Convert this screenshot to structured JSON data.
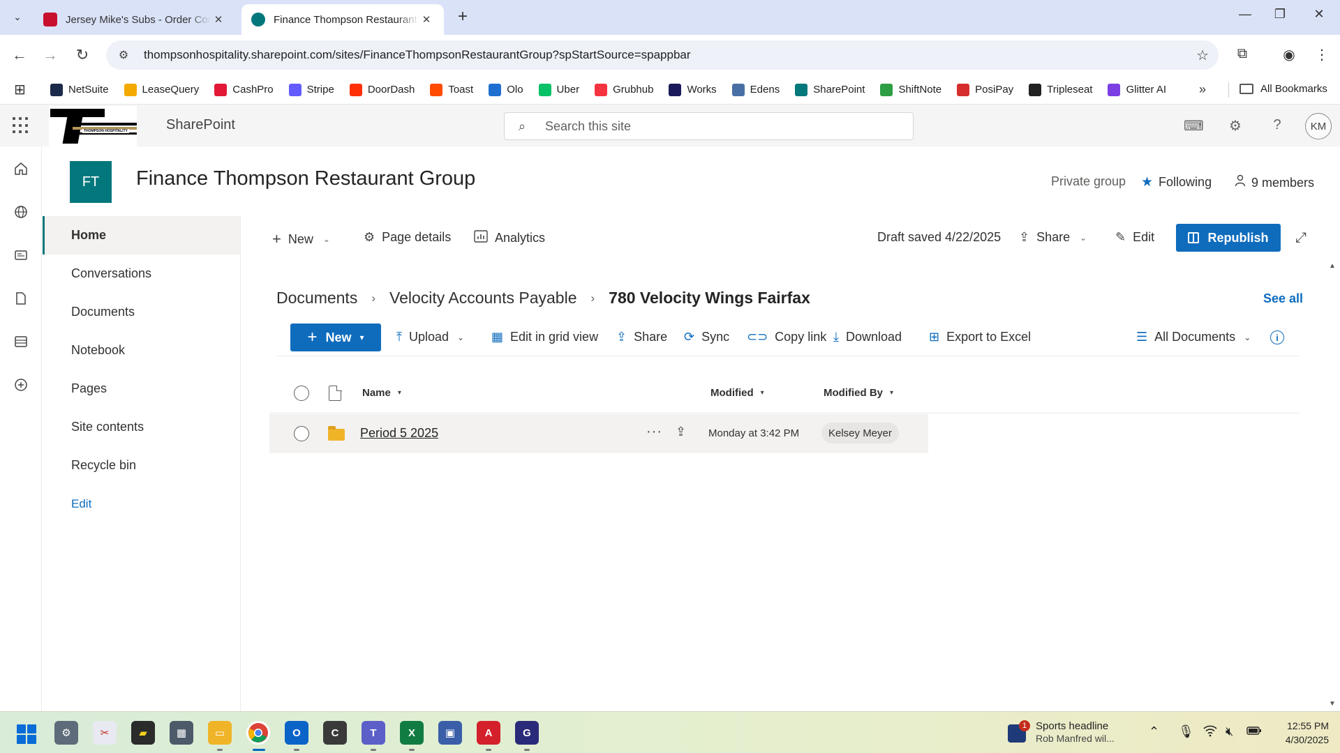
{
  "browser": {
    "tabs": [
      {
        "title": "Jersey Mike's Subs - Order Com",
        "active": false,
        "favicon_color": "#c8102e"
      },
      {
        "title": "Finance Thompson Restaurant G",
        "active": true,
        "favicon_color": "#03787c"
      }
    ],
    "new_tab_symbol": "+",
    "url": "thompsonhospitality.sharepoint.com/sites/FinanceThompsonRestaurantGroup?spStartSource=spappbar",
    "bookmarks": [
      {
        "label": "NetSuite",
        "color": "#1b2a4a",
        "icon": "netsuite-icon"
      },
      {
        "label": "LeaseQuery",
        "color": "#f2a900",
        "icon": "leasequery-icon"
      },
      {
        "label": "CashPro",
        "color": "#e31837",
        "icon": "cashpro-icon"
      },
      {
        "label": "Stripe",
        "color": "#635bff",
        "icon": "stripe-icon"
      },
      {
        "label": "DoorDash",
        "color": "#ff3008",
        "icon": "doordash-icon"
      },
      {
        "label": "Toast",
        "color": "#ff4c00",
        "icon": "toast-icon"
      },
      {
        "label": "Olo",
        "color": "#1f6fd1",
        "icon": "olo-icon"
      },
      {
        "label": "Uber",
        "color": "#06c167",
        "icon": "uber-icon"
      },
      {
        "label": "Grubhub",
        "color": "#f63440",
        "icon": "grubhub-icon"
      },
      {
        "label": "Works",
        "color": "#1a1a5a",
        "icon": "works-icon"
      },
      {
        "label": "Edens",
        "color": "#4a6fa5",
        "icon": "edens-icon"
      },
      {
        "label": "SharePoint",
        "color": "#03787c",
        "icon": "sharepoint-icon"
      },
      {
        "label": "ShiftNote",
        "color": "#2e9e44",
        "icon": "shiftnote-icon"
      },
      {
        "label": "PosiPay",
        "color": "#d62e2e",
        "icon": "posipay-icon"
      },
      {
        "label": "Tripleseat",
        "color": "#222222",
        "icon": "tripleseat-icon"
      },
      {
        "label": "Glitter AI",
        "color": "#7b3fe4",
        "icon": "glitter-ai-icon"
      }
    ],
    "all_bookmarks": "All Bookmarks"
  },
  "suite": {
    "brand": "SharePoint",
    "logo_text": "THOMPSON HOSPITALITY",
    "search_placeholder": "Search this site",
    "avatar_initials": "KM"
  },
  "site": {
    "logo_initials": "FT",
    "title": "Finance Thompson Restaurant Group",
    "privacy": "Private group",
    "following": "Following",
    "members": "9 members"
  },
  "nav": {
    "items": [
      "Home",
      "Conversations",
      "Documents",
      "Notebook",
      "Pages",
      "Site contents",
      "Recycle bin"
    ],
    "edit": "Edit"
  },
  "command_bar": {
    "new": "New",
    "page_details": "Page details",
    "analytics": "Analytics",
    "draft_status": "Draft saved 4/22/2025",
    "share": "Share",
    "edit": "Edit",
    "republish": "Republish"
  },
  "library": {
    "breadcrumb": [
      "Documents",
      "Velocity Accounts Payable",
      "780 Velocity Wings Fairfax"
    ],
    "see_all": "See all",
    "toolbar": {
      "new": "New",
      "upload": "Upload",
      "edit_grid": "Edit in grid view",
      "share": "Share",
      "sync": "Sync",
      "copy_link": "Copy link",
      "download": "Download",
      "export": "Export to Excel",
      "view": "All Documents"
    },
    "columns": {
      "name": "Name",
      "modified": "Modified",
      "modified_by": "Modified By"
    },
    "rows": [
      {
        "name": "Period 5 2025",
        "modified": "Monday at 3:42 PM",
        "modified_by": "Kelsey Meyer"
      }
    ]
  },
  "taskbar": {
    "news_badge": "1",
    "news_title": "Sports headline",
    "news_sub": "Rob Manfred wil...",
    "time": "12:55 PM",
    "date": "4/30/2025"
  }
}
